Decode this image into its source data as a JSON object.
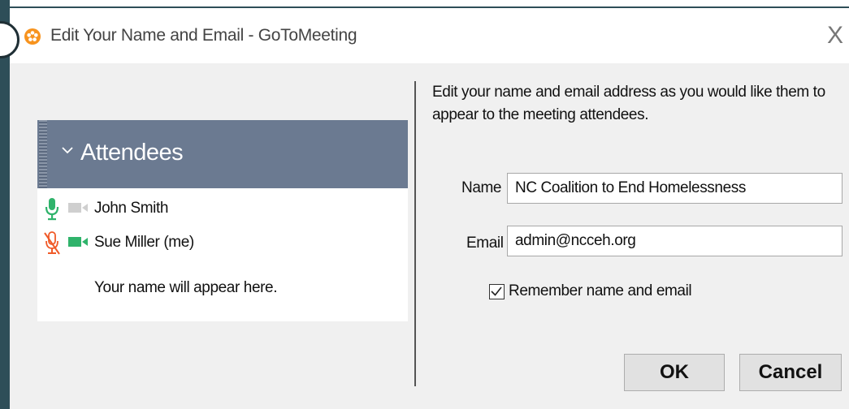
{
  "window": {
    "title": "Edit Your Name and Email - GoToMeeting",
    "close_glyph": "X",
    "app_icon": "gotomeeting-flower-icon"
  },
  "preview": {
    "header_label": "Attendees",
    "attendees": [
      {
        "name": "John Smith",
        "mic": "on",
        "camera": "off"
      },
      {
        "name": "Sue Miller (me)",
        "mic": "muted",
        "camera": "on"
      }
    ],
    "note": "Your name will appear here."
  },
  "form": {
    "instructions": "Edit your name and email address as you would like them to appear to the meeting attendees.",
    "name_label": "Name",
    "name_value": "NC Coalition to End Homelessness",
    "email_label": "Email",
    "email_value": "admin@ncceh.org",
    "remember_label": "Remember name and email",
    "remember_checked": true
  },
  "buttons": {
    "ok": "OK",
    "cancel": "Cancel"
  },
  "colors": {
    "frame": "#2e4e58",
    "header_bg": "#6b7a91",
    "mic_on": "#2fb36b",
    "mic_muted": "#f05a28",
    "camera_on": "#2fb36b",
    "camera_off": "#cfcfcf",
    "app_icon": "#f7931e"
  }
}
